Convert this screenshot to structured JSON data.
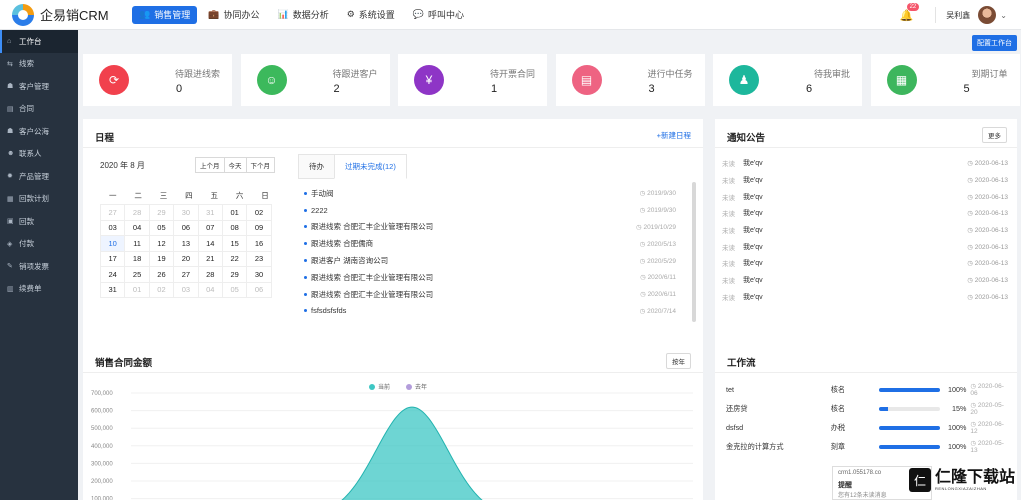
{
  "app": {
    "title": "企易销CRM"
  },
  "topnav": [
    {
      "label": "销售管理",
      "icon": "people-icon",
      "active": true
    },
    {
      "label": "协同办公",
      "icon": "briefcase-icon",
      "active": false
    },
    {
      "label": "数据分析",
      "icon": "chart-icon",
      "active": false
    },
    {
      "label": "系统设置",
      "icon": "gear-icon",
      "active": false
    },
    {
      "label": "呼叫中心",
      "icon": "chat-icon",
      "active": false
    }
  ],
  "header": {
    "notification_count": "22",
    "username": "吴利鑫"
  },
  "sidebar": [
    {
      "label": "工作台",
      "icon": "home-icon",
      "active": true
    },
    {
      "label": "线索",
      "icon": "clue-icon",
      "active": false
    },
    {
      "label": "客户管理",
      "icon": "customer-icon",
      "active": false
    },
    {
      "label": "合同",
      "icon": "contract-icon",
      "active": false
    },
    {
      "label": "客户公海",
      "icon": "sea-icon",
      "active": false
    },
    {
      "label": "联系人",
      "icon": "contact-icon",
      "active": false
    },
    {
      "label": "产品管理",
      "icon": "product-icon",
      "active": false
    },
    {
      "label": "回款计划",
      "icon": "plan-icon",
      "active": false
    },
    {
      "label": "回款",
      "icon": "payment-icon",
      "active": false
    },
    {
      "label": "付款",
      "icon": "pay-icon",
      "active": false
    },
    {
      "label": "销项发票",
      "icon": "invoice-icon",
      "active": false
    },
    {
      "label": "续费单",
      "icon": "renew-icon",
      "active": false
    }
  ],
  "config_button": "配置工作台",
  "stats": [
    {
      "label": "待跟进线索",
      "value": "0",
      "color": "#f1414d",
      "icon": "link-icon"
    },
    {
      "label": "待跟进客户",
      "value": "2",
      "color": "#3cb95c",
      "icon": "user-icon"
    },
    {
      "label": "待开票合同",
      "value": "1",
      "color": "#8e35c6",
      "icon": "yen-icon"
    },
    {
      "label": "进行中任务",
      "value": "3",
      "color": "#ee6382",
      "icon": "task-icon"
    },
    {
      "label": "待我审批",
      "value": "6",
      "color": "#1db79c",
      "icon": "approve-icon"
    },
    {
      "label": "到期订单",
      "value": "5",
      "color": "#3db65d",
      "icon": "document-icon"
    }
  ],
  "schedule": {
    "title": "日程",
    "new_label": "+新建日程",
    "month": "2020 年 8 月",
    "buttons": [
      "上个月",
      "今天",
      "下个月"
    ],
    "weekdays": [
      "一",
      "二",
      "三",
      "四",
      "五",
      "六",
      "日"
    ],
    "weeks": [
      [
        "27",
        "28",
        "29",
        "30",
        "31",
        "01",
        "02"
      ],
      [
        "03",
        "04",
        "05",
        "06",
        "07",
        "08",
        "09"
      ],
      [
        "10",
        "11",
        "12",
        "13",
        "14",
        "15",
        "16"
      ],
      [
        "17",
        "18",
        "19",
        "20",
        "21",
        "22",
        "23"
      ],
      [
        "24",
        "25",
        "26",
        "27",
        "28",
        "29",
        "30"
      ],
      [
        "31",
        "01",
        "02",
        "03",
        "04",
        "05",
        "06"
      ]
    ],
    "today": "10",
    "tabs": [
      "待办",
      "过期未完成(12)"
    ],
    "tasks": [
      {
        "text": "手动阀",
        "date": "2019/9/30"
      },
      {
        "text": "2222",
        "date": "2019/9/30"
      },
      {
        "text": "跟进线索 合肥汇丰企业管理有限公司",
        "date": "2019/10/29"
      },
      {
        "text": "跟进线索 合肥儒商",
        "date": "2020/5/13"
      },
      {
        "text": "跟进客户 湖南咨询公司",
        "date": "2020/5/29"
      },
      {
        "text": "跟进线索 合肥汇丰企业管理有限公司",
        "date": "2020/6/11"
      },
      {
        "text": "跟进线索 合肥汇丰企业管理有限公司",
        "date": "2020/6/11"
      },
      {
        "text": "fsfsdsfsfds",
        "date": "2020/7/14"
      }
    ]
  },
  "notices": {
    "title": "通知公告",
    "more": "更多",
    "items": [
      {
        "status": "未读",
        "text": "我e'qv",
        "date": "2020-06-13"
      },
      {
        "status": "未读",
        "text": "我e'qv",
        "date": "2020-06-13"
      },
      {
        "status": "未读",
        "text": "我e'qv",
        "date": "2020-06-13"
      },
      {
        "status": "未读",
        "text": "我e'qv",
        "date": "2020-06-13"
      },
      {
        "status": "未读",
        "text": "我e'qv",
        "date": "2020-06-13"
      },
      {
        "status": "未读",
        "text": "我e'qv",
        "date": "2020-06-13"
      },
      {
        "status": "未读",
        "text": "我e'qv",
        "date": "2020-06-13"
      },
      {
        "status": "未读",
        "text": "我e'qv",
        "date": "2020-06-13"
      },
      {
        "status": "未读",
        "text": "我e'qv",
        "date": "2020-06-13"
      }
    ]
  },
  "sales": {
    "title": "销售合同金额",
    "period_button": "按年"
  },
  "chart_data": {
    "type": "area",
    "series": [
      {
        "name": "当前",
        "color": "#3ec7c4",
        "peak": 620000,
        "center": 0.5,
        "width": 0.09
      },
      {
        "name": "去年",
        "color": "#b39ddb",
        "peak": 0
      }
    ],
    "yticks": [
      "700,000",
      "600,000",
      "500,000",
      "400,000",
      "300,000",
      "200,000",
      "100,000"
    ],
    "ylim": [
      0,
      700000
    ]
  },
  "workflow": {
    "title": "工作流",
    "items": [
      {
        "name": "tet",
        "step": "核名",
        "percent": 100,
        "percent_label": "100%",
        "date": "2020-06-06"
      },
      {
        "name": "还房贷",
        "step": "核名",
        "percent": 15,
        "percent_label": "15%",
        "date": "2020-05-20"
      },
      {
        "name": "dsfsd",
        "step": "办税",
        "percent": 100,
        "percent_label": "100%",
        "date": "2020-06-12"
      },
      {
        "name": "金克拉的计算方式",
        "step": "刻章",
        "percent": 100,
        "percent_label": "100%",
        "date": "2020-05-13"
      }
    ]
  },
  "toast": {
    "url": "crm1.055178.co",
    "title": "提醒",
    "text": "您有12条未读消息"
  },
  "watermark": {
    "name": "仁隆下载站",
    "sub": "RENLONGXIAZAIZHAN"
  }
}
